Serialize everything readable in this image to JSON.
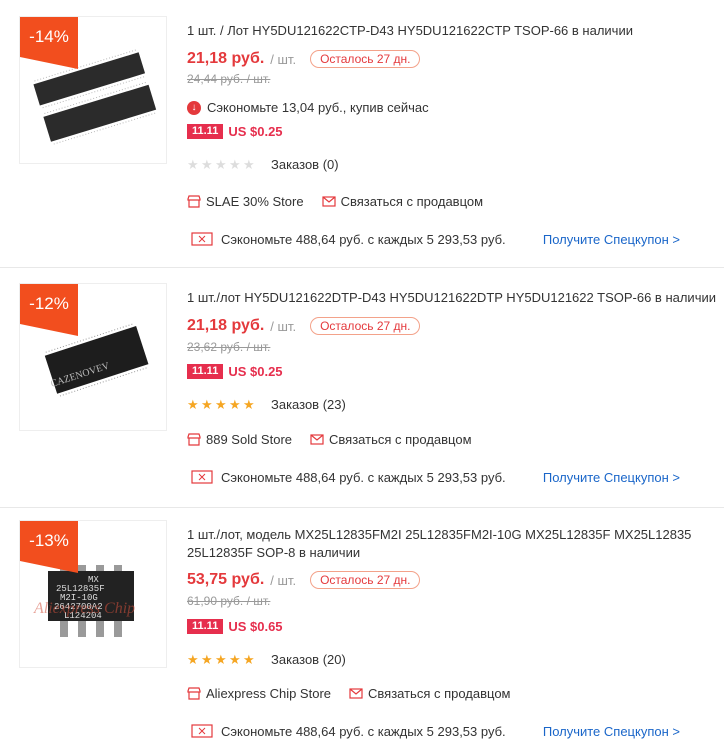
{
  "items": [
    {
      "discount": "-14%",
      "title": "1 шт. / Лот HY5DU121622CTP-D43 HY5DU121622CTP TSOP-66 в наличии",
      "price": "21,18 руб.",
      "per_unit": "/ шт.",
      "remaining": "Осталось 27 дн.",
      "old_price": "24,44 руб. / шт.",
      "save_now": "Сэкономьте 13,04 руб., купив сейчас",
      "promo_tag": "11.11",
      "promo_value": "US $0.25",
      "stars": 0,
      "orders": "Заказов (0)",
      "store": "SLAE 30% Store",
      "contact": "Связаться с продавцом",
      "coupon_text": "Сэкономьте 488,64 руб. с каждых 5 293,53 руб.",
      "coupon_link": "Получите Спецкупон >"
    },
    {
      "discount": "-12%",
      "title": "1 шт./лот HY5DU121622DTP-D43 HY5DU121622DTP HY5DU121622 TSOP-66 в наличии",
      "price": "21,18 руб.",
      "per_unit": "/ шт.",
      "remaining": "Осталось 27 дн.",
      "old_price": "23,62 руб. / шт.",
      "promo_tag": "11.11",
      "promo_value": "US $0.25",
      "stars": 5,
      "orders": "Заказов (23)",
      "store": "889 Sold Store",
      "contact": "Связаться с продавцом",
      "coupon_text": "Сэкономьте 488,64 руб. с каждых 5 293,53 руб.",
      "coupon_link": "Получите Спецкупон >",
      "image_text": "CAZENOVEV"
    },
    {
      "discount": "-13%",
      "title": "1 шт./лот, модель MX25L12835FM2I 25L12835FM2I-10G MX25L12835F MX25L12835 25L12835F SOP-8 в наличии",
      "price": "53,75 руб.",
      "per_unit": "/ шт.",
      "remaining": "Осталось 27 дн.",
      "old_price": "61,90 руб. / шт.",
      "promo_tag": "11.11",
      "promo_value": "US $0.65",
      "stars": 5,
      "orders": "Заказов (20)",
      "store": "Aliexpress Chip Store",
      "contact": "Связаться с продавцом",
      "coupon_text": "Сэкономьте 488,64 руб. с каждых 5 293,53 руб.",
      "coupon_link": "Получите Спецкупон >",
      "image_text": [
        "MX",
        "25L12835F",
        "M2I-10G",
        "2642700A2",
        "L124204"
      ],
      "watermark": "Aliexpress Chip"
    }
  ],
  "colors": {
    "accent": "#e4393c",
    "badge": "#f24e1e",
    "promo": "#e62e4d",
    "link": "#1a66c9",
    "star_on": "#f5a623",
    "star_off": "#dddddd"
  }
}
